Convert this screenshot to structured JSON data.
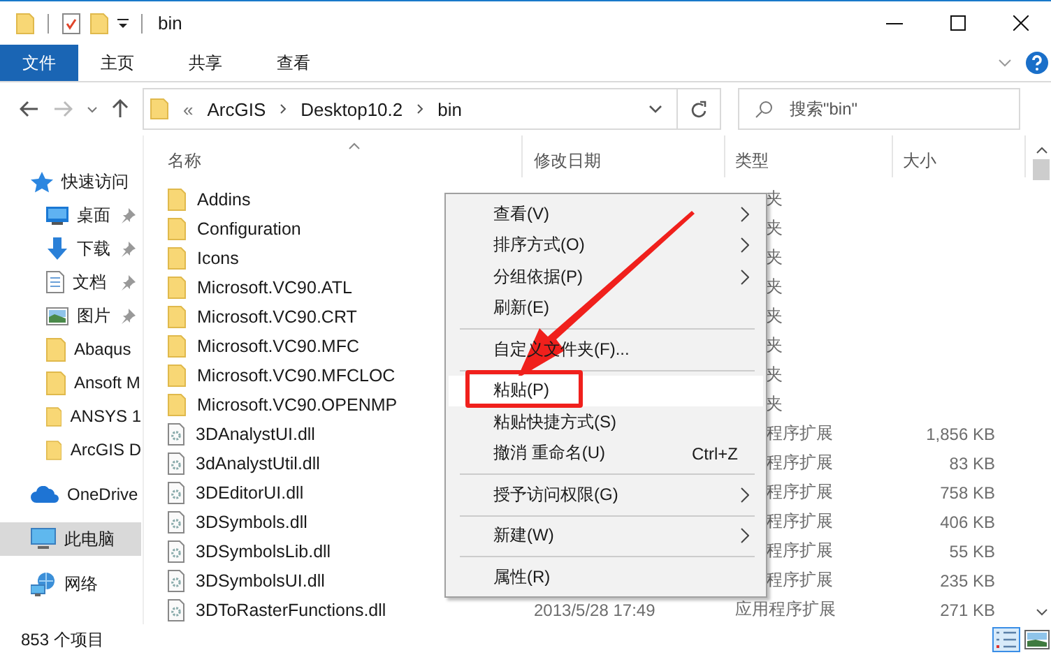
{
  "window": {
    "title": "bin"
  },
  "ribbon_tabs": [
    {
      "label": "文件",
      "selected": true
    },
    {
      "label": "主页",
      "selected": false
    },
    {
      "label": "共享",
      "selected": false
    },
    {
      "label": "查看",
      "selected": false
    }
  ],
  "address": {
    "overflow": "«",
    "segments": [
      "ArcGIS",
      "Desktop10.2",
      "bin"
    ]
  },
  "search": {
    "placeholder": "搜索\"bin\""
  },
  "sidebar": {
    "items": [
      {
        "label": "快速访问",
        "kind": "quick",
        "pinned": false,
        "selected": false
      },
      {
        "label": "桌面",
        "kind": "desktop",
        "pinned": true,
        "selected": false
      },
      {
        "label": "下载",
        "kind": "download",
        "pinned": true,
        "selected": false
      },
      {
        "label": "文档",
        "kind": "documents",
        "pinned": true,
        "selected": false
      },
      {
        "label": "图片",
        "kind": "pictures",
        "pinned": true,
        "selected": false
      },
      {
        "label": "Abaqus",
        "kind": "folder",
        "pinned": false,
        "selected": false
      },
      {
        "label": "Ansoft M",
        "kind": "folder",
        "pinned": false,
        "selected": false
      },
      {
        "label": "ANSYS 1",
        "kind": "folder",
        "pinned": false,
        "selected": false
      },
      {
        "label": "ArcGIS D",
        "kind": "folder",
        "pinned": false,
        "selected": false
      },
      {
        "label": "OneDrive",
        "kind": "onedrive",
        "pinned": false,
        "selected": false
      },
      {
        "label": "此电脑",
        "kind": "pc",
        "pinned": false,
        "selected": true
      },
      {
        "label": "网络",
        "kind": "network",
        "pinned": false,
        "selected": false
      }
    ]
  },
  "columns": [
    "名称",
    "修改日期",
    "类型",
    "大小"
  ],
  "files": [
    {
      "name": "Addins",
      "kind": "folder",
      "type": "夹"
    },
    {
      "name": "Configuration",
      "kind": "folder",
      "type": "夹"
    },
    {
      "name": "Icons",
      "kind": "folder",
      "type": "夹"
    },
    {
      "name": "Microsoft.VC90.ATL",
      "kind": "folder",
      "type": "夹"
    },
    {
      "name": "Microsoft.VC90.CRT",
      "kind": "folder",
      "type": "夹"
    },
    {
      "name": "Microsoft.VC90.MFC",
      "kind": "folder",
      "type": "夹"
    },
    {
      "name": "Microsoft.VC90.MFCLOC",
      "kind": "folder",
      "type": "夹"
    },
    {
      "name": "Microsoft.VC90.OPENMP",
      "kind": "folder",
      "type": "夹"
    },
    {
      "name": "3DAnalystUI.dll",
      "kind": "dll",
      "type": "程序扩展",
      "size": "1,856 KB"
    },
    {
      "name": "3dAnalystUtil.dll",
      "kind": "dll",
      "type": "程序扩展",
      "size": "83 KB"
    },
    {
      "name": "3DEditorUI.dll",
      "kind": "dll",
      "type": "程序扩展",
      "size": "758 KB"
    },
    {
      "name": "3DSymbols.dll",
      "kind": "dll",
      "type": "程序扩展",
      "size": "406 KB"
    },
    {
      "name": "3DSymbolsLib.dll",
      "kind": "dll",
      "type": "程序扩展",
      "size": "55 KB"
    },
    {
      "name": "3DSymbolsUI.dll",
      "kind": "dll",
      "type": "程序扩展",
      "size": "235 KB"
    },
    {
      "name": "3DToRasterFunctions.dll",
      "kind": "dll",
      "date": "2013/5/28 17:49",
      "type": "应用程序扩展",
      "size": "271 KB"
    }
  ],
  "context_menu": {
    "items": [
      {
        "kind": "item",
        "label": "查看(V)",
        "submenu": true,
        "highlighted": false
      },
      {
        "kind": "item",
        "label": "排序方式(O)",
        "submenu": true,
        "highlighted": false
      },
      {
        "kind": "item",
        "label": "分组依据(P)",
        "submenu": true,
        "highlighted": false
      },
      {
        "kind": "item",
        "label": "刷新(E)",
        "submenu": false,
        "highlighted": false
      },
      {
        "kind": "separator"
      },
      {
        "kind": "item",
        "label": "自定义文件夹(F)...",
        "submenu": false,
        "highlighted": false
      },
      {
        "kind": "separator"
      },
      {
        "kind": "item",
        "label": "粘贴(P)",
        "submenu": false,
        "highlighted": true
      },
      {
        "kind": "item",
        "label": "粘贴快捷方式(S)",
        "submenu": false,
        "highlighted": false
      },
      {
        "kind": "item",
        "label": "撤消 重命名(U)",
        "shortcut": "Ctrl+Z",
        "submenu": false,
        "highlighted": false
      },
      {
        "kind": "separator"
      },
      {
        "kind": "item",
        "label": "授予访问权限(G)",
        "submenu": true,
        "highlighted": false
      },
      {
        "kind": "separator"
      },
      {
        "kind": "item",
        "label": "新建(W)",
        "submenu": true,
        "highlighted": false
      },
      {
        "kind": "separator"
      },
      {
        "kind": "item",
        "label": "属性(R)",
        "submenu": false,
        "highlighted": false
      }
    ]
  },
  "status_bar": {
    "count": "853 个项目",
    "views": [
      {
        "kind": "details",
        "selected": true
      },
      {
        "kind": "large-icons",
        "selected": false
      }
    ]
  }
}
